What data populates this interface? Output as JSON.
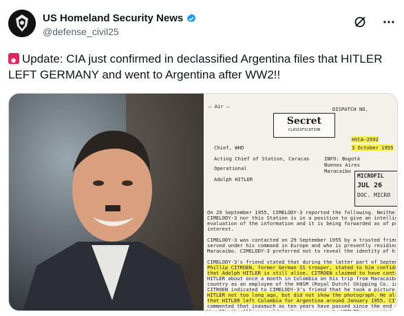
{
  "account": {
    "display_name": "US Homeland Security News",
    "handle": "@defense_civil25"
  },
  "tweet": {
    "text": "Update: CIA just confirmed in declassified Argentina files that HITLER LEFT GERMANY and went to Argentina after WW2!!"
  },
  "icons": {
    "alert": "rotating-light-icon",
    "verified": "verified-badge-icon",
    "grok": "grok-icon",
    "more": "more-icon"
  },
  "colors": {
    "verified": "#1d9bf0",
    "highlight": "#f7ee4a",
    "alarm": "#e0245e"
  },
  "document": {
    "classification_label": "Secret",
    "classification_sub": "CLASSIFICATION",
    "dispatch": "DISPATCH NO.",
    "dispatch_no": "HVCA-2592",
    "date": "3 October 1955",
    "to": "Chief, WHD",
    "from": "Acting Chief of Station, Caracas",
    "info": "INFO: Bogotá Buenos Aires Maracaibo",
    "general": "Operational",
    "specific": "Adolph HITLER",
    "microfilm": "MICROFIL",
    "microfilm_date": "JUL 26",
    "doc_micro": "DOC. MICRO",
    "lines": [
      "On 29 September 1955, CIMELODY-3 reported the following. Neither",
      "CIMELODY-3 nor this Station is in a position to give an intelligent",
      "evaluation of the information and it is being forwarded as of possib",
      "interest.",
      "CIMELODY-3 was contacted on 29 September 1955 by a trusted friend wh",
      "served under his command in Europe and who is presently residing in",
      "Maracaibo. CIMELODY-3 preferred not to reveal the identity of his f",
      "CIMELODY-3's friend stated that during the latter part of September",
      "Phillip CITROEN, former German SS trooper, stated to him confident",
      "that Adolph HITLER is still alive. CITROEN claimed to have contacte",
      "HITLER about once a month in Colombia on his trip from Maracaibo to",
      "country as an employee of the KNSM (Royal Dutch) Shipping Co. in Mar",
      "CITROEN indicated to CIMELODY-3's friend that he took a picture with",
      "HITLER not too long ago, but did not show the photograph. He also s",
      "that HITLER left Colombia for Argentina around January 1955. CITROEN",
      "commented that inasmuch as ten years have passed since the end of Wo",
      "War II, the Allies could no longer prosecute HITLER as a criminal o"
    ]
  }
}
